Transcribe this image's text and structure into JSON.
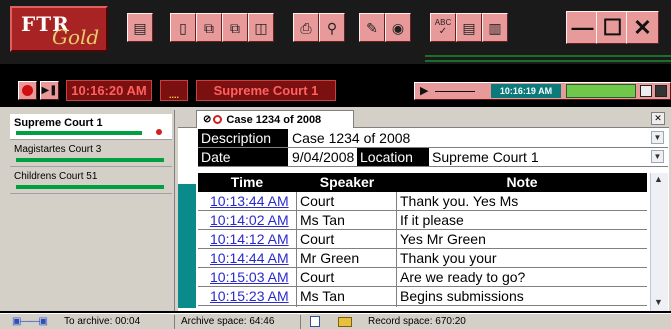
{
  "app": {
    "logo_main": "FTR",
    "logo_sub": "Gold"
  },
  "toolbar": {
    "icons": [
      "notes-icon",
      "new-document-icon",
      "copy-icon",
      "copy-multi-icon",
      "paste-icon",
      "print-icon",
      "print-preview-icon",
      "edit-icon",
      "find-icon",
      "spell-check-icon",
      "document-search-icon",
      "report-icon"
    ],
    "spell_label": "ABC",
    "window_buttons": [
      "minimize",
      "maximize",
      "close"
    ]
  },
  "recorder": {
    "record_time": "10:16:20 AM",
    "dots": "....",
    "room": "Supreme Court 1",
    "playback_time": "10:16:19 AM"
  },
  "courts": [
    {
      "name": "Supreme Court 1",
      "active": true
    },
    {
      "name": "Magistartes Court 3",
      "active": false
    },
    {
      "name": "Childrens Court 51",
      "active": false
    }
  ],
  "case_tab": {
    "label": "Case 1234 of 2008"
  },
  "header_fields": {
    "description_label": "Description",
    "description_value": "Case 1234 of 2008",
    "date_label": "Date",
    "date_value": "9/04/2008",
    "location_label": "Location",
    "location_value": "Supreme Court 1"
  },
  "log_table": {
    "columns": [
      "Time",
      "Speaker",
      "Note"
    ],
    "rows": [
      {
        "time": "10:13:44 AM",
        "speaker": "Court",
        "note": "Thank you.  Yes Ms"
      },
      {
        "time": "10:14:02 AM",
        "speaker": "Ms Tan",
        "note": "If it please"
      },
      {
        "time": "10:14:12 AM",
        "speaker": "Court",
        "note": "Yes Mr Green"
      },
      {
        "time": "10:14:44 AM",
        "speaker": "Mr Green",
        "note": "Thank you your"
      },
      {
        "time": "10:15:03 AM",
        "speaker": "Court",
        "note": "Are we ready to go?"
      },
      {
        "time": "10:15:23 AM",
        "speaker": "Ms Tan",
        "note": "Begins submissions"
      }
    ]
  },
  "status_bar": {
    "archive": "To archive: 00:04",
    "archive_space": "Archive space: 64:46",
    "record_space": "Record space: 670:20"
  },
  "colors": {
    "accent_red": "#a82323",
    "button_pink": "#e89a9a",
    "level_green": "#00a040",
    "link_blue": "#2a2acc"
  }
}
